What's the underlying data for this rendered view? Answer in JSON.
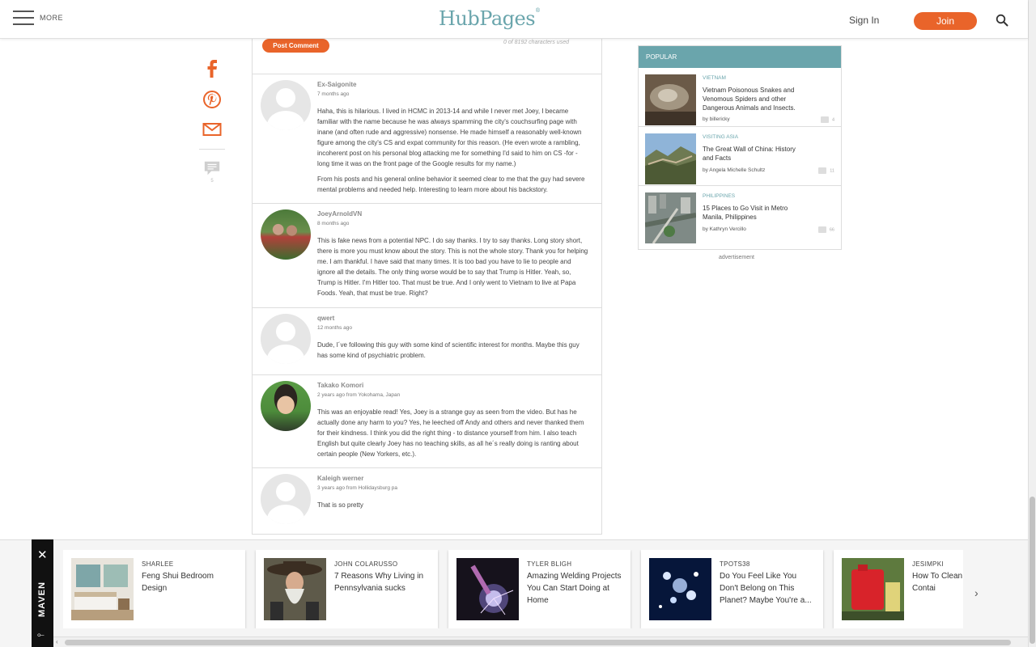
{
  "header": {
    "menu_label": "MORE",
    "logo": "HubPages",
    "logo_mark": "®",
    "signin": "Sign In",
    "join": "Join"
  },
  "share": {
    "comment_count": "5"
  },
  "comment_form": {
    "post_button": "Post Comment",
    "char_counter": "0 of 8192 characters used"
  },
  "comments": [
    {
      "name": "Ex-Saigonite",
      "meta": "7 months ago",
      "paragraphs": [
        "Haha, this is hilarious. I lived in HCMC in 2013-14 and while I never met Joey, I became familiar with the name because he was always spamming the city's couchsurfing page with inane (and often rude and aggressive) nonsense. He made himself a reasonably well-known figure among the city's CS and expat community for this reason. (He even wrote a rambling, incoherent post on his personal blog attacking me for something I'd said to him on CS -for - long time it was on the front page of the Google results for my name.)",
        "From his posts and his general online behavior it seemed clear to me that the guy had severe mental problems and needed help. Interesting to learn more about his backstory."
      ]
    },
    {
      "name": "JoeyArnoldVN",
      "meta": "8 months ago",
      "paragraphs": [
        "This is fake news from a potential NPC. I do say thanks. I try to say thanks. Long story short, there is more you must know about the story. This is not the whole story. Thank you for helping me. I am thankful. I have said that many times. It is too bad you have to lie to people and ignore all the details. The only thing worse would be to say that Trump is Hitler. Yeah, so, Trump is Hitler. I'm Hitler too. That must be true. And I only went to Vietnam to live at Papa Foods. Yeah, that must be true. Right?"
      ]
    },
    {
      "name": "qwert",
      "meta": "12 months ago",
      "paragraphs": [
        "Dude, I´ve following this guy with some kind of scientific interest for months. Maybe this guy has some kind of psychiatric problem."
      ]
    },
    {
      "name": "Takako Komori",
      "meta": "2 years ago from Yokohama, Japan",
      "paragraphs": [
        "This was an enjoyable read! Yes, Joey is a strange guy as seen from the video. But has he actually done any harm to you? Yes, he leeched off Andy and others and never thanked them for their kindness. I think you did the right thing - to distance yourself from him. I also teach English but quite clearly Joey has no teaching skills, as all he´s really doing is ranting about certain people (New Yorkers, etc.)."
      ]
    },
    {
      "name": "Kaleigh werner",
      "meta": "3 years ago from Hollidaysburg pa",
      "paragraphs": [
        "That is so pretty"
      ]
    }
  ],
  "popular": {
    "heading": "POPULAR",
    "items": [
      {
        "category": "VIETNAM",
        "title": "Vietnam Poisonous Snakes and Venomous Spiders and other Dangerous Animals and Insects.",
        "author": "by billericky",
        "count": "4"
      },
      {
        "category": "VISITING ASIA",
        "title": "The Great Wall of China: History and Facts",
        "author": "by Angela Michelle Schultz",
        "count": "11"
      },
      {
        "category": "PHILIPPINES",
        "title": "15 Places to Go Visit in Metro Manila, Philippines",
        "author": "by Kathryn Vercillo",
        "count": "66"
      }
    ]
  },
  "advertisement_label": "advertisement",
  "maven": {
    "label": "MAVEN",
    "close": "✕",
    "cards": [
      {
        "author": "SHARLEE",
        "title": "Feng Shui Bedroom Design"
      },
      {
        "author": "JOHN COLARUSSO",
        "title": "7 Reasons Why Living in Pennsylvania sucks"
      },
      {
        "author": "TYLER BLIGH",
        "title": "Amazing Welding Projects You Can Start Doing at Home"
      },
      {
        "author": "TPOTS38",
        "title": "Do You Feel Like You Don't Belong on This Planet? Maybe You're a..."
      },
      {
        "author": "JESIMPKI",
        "title": "How To Clean Can Or Contai"
      }
    ]
  },
  "colors": {
    "accent_orange": "#e9642a",
    "brand_teal": "#6aa5ac"
  }
}
